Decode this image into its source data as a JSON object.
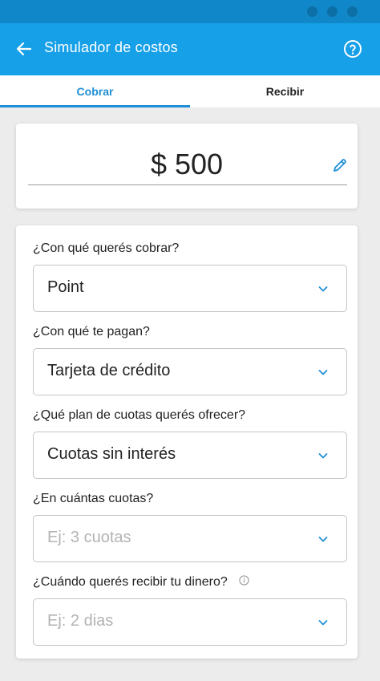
{
  "header": {
    "title": "Simulador de costos",
    "back_icon": "arrow-left-icon",
    "help_icon": "help-circle-icon",
    "color": "#16a0e8"
  },
  "tabs": [
    {
      "label": "Cobrar",
      "active": true
    },
    {
      "label": "Recibir",
      "active": false
    }
  ],
  "amount": {
    "value": "$ 500",
    "edit_icon": "pencil-icon"
  },
  "form": {
    "fields": [
      {
        "question": "¿Con qué querés cobrar?",
        "value": "Point",
        "placeholder": false
      },
      {
        "question": "¿Con qué te pagan?",
        "value": "Tarjeta de crédito",
        "placeholder": false
      },
      {
        "question": "¿Qué plan de cuotas querés ofrecer?",
        "value": "Cuotas sin interés",
        "placeholder": false
      },
      {
        "question": "¿En cuántas cuotas?",
        "value": "Ej: 3 cuotas",
        "placeholder": true
      },
      {
        "question": "¿Cuándo querés recibir tu dinero?",
        "value": "Ej: 2 dias",
        "placeholder": true,
        "info_icon": "info-icon"
      }
    ]
  },
  "colors": {
    "accent": "#1e8fd5",
    "status_bar": "#0f87c9",
    "placeholder": "#b3b3b3"
  }
}
